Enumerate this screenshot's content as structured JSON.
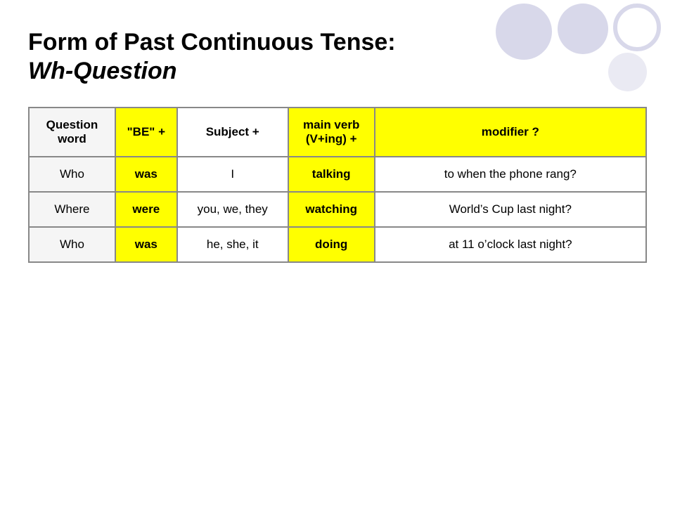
{
  "page": {
    "title_main": "Form of Past Continuous Tense:",
    "title_sub": "Wh-Question"
  },
  "table": {
    "headers": {
      "question_word": "Question word",
      "be": "\"BE\" +",
      "subject": "Subject +",
      "main_verb": "main verb (V+ing) +",
      "modifier": "modifier ?"
    },
    "rows": [
      {
        "question_word": "Who",
        "be": "was",
        "subject": "I",
        "verb": "talking",
        "modifier": "to when the phone rang?"
      },
      {
        "question_word": "Where",
        "be": "were",
        "subject": "you, we, they",
        "verb": "watching",
        "modifier": "World’s Cup last night?"
      },
      {
        "question_word": "Who",
        "be": "was",
        "subject": "he, she, it",
        "verb": "doing",
        "modifier": "at 11 o’clock last night?"
      }
    ]
  }
}
